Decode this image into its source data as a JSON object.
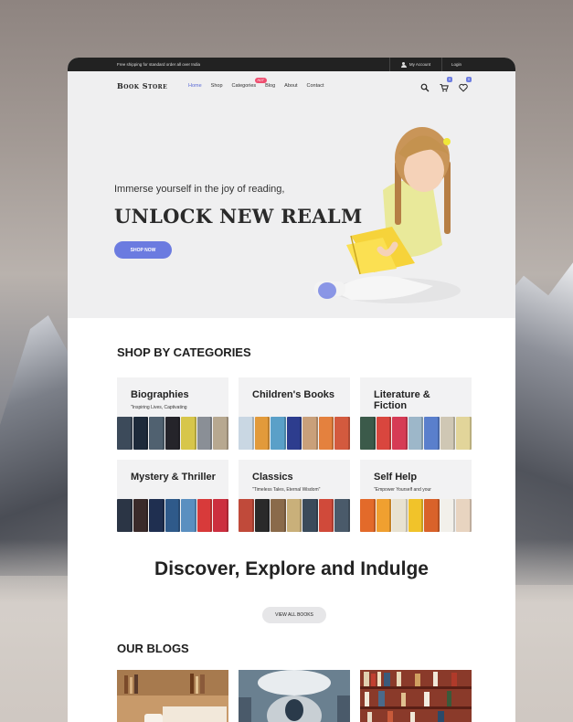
{
  "topbar": {
    "shipping": "Free shipping for standard order all over India",
    "account": "My Account",
    "login": "Login"
  },
  "nav": {
    "logo": "Book Store",
    "menu": [
      {
        "label": "Home",
        "active": true
      },
      {
        "label": "Shop"
      },
      {
        "label": "Categories",
        "badge": "HOT"
      },
      {
        "label": "Blog"
      },
      {
        "label": "About"
      },
      {
        "label": "Contact"
      }
    ],
    "icons": [
      "search-icon",
      "cart-icon",
      "heart-icon"
    ],
    "cart_count": "0",
    "wishlist_count": "0"
  },
  "hero": {
    "subtitle": "Immerse yourself in the joy of reading,",
    "title": "UNLOCK NEW REALM",
    "button": "SHOP NOW"
  },
  "categories": {
    "heading": "SHOP BY CATEGORIES",
    "items": [
      {
        "title": "Biographies",
        "desc": "\"Inspiring Lives, Captivating"
      },
      {
        "title": "Children's Books",
        "desc": ""
      },
      {
        "title": "Literature & Fiction",
        "desc": ""
      },
      {
        "title": "Mystery & Thriller",
        "desc": ""
      },
      {
        "title": "Classics",
        "desc": "\"Timeless Tales, Eternal Wisdom\""
      },
      {
        "title": "Self Help",
        "desc": "\"Empower Yourself and your"
      }
    ]
  },
  "discover": {
    "title": "Discover, Explore and Indulge",
    "button": "VIEW ALL BOOKS"
  },
  "blogs": {
    "heading": "OUR BLOGS"
  },
  "colors": {
    "accent": "#6b7be0",
    "badge": "#ef4d6f",
    "topbar": "#222222"
  }
}
